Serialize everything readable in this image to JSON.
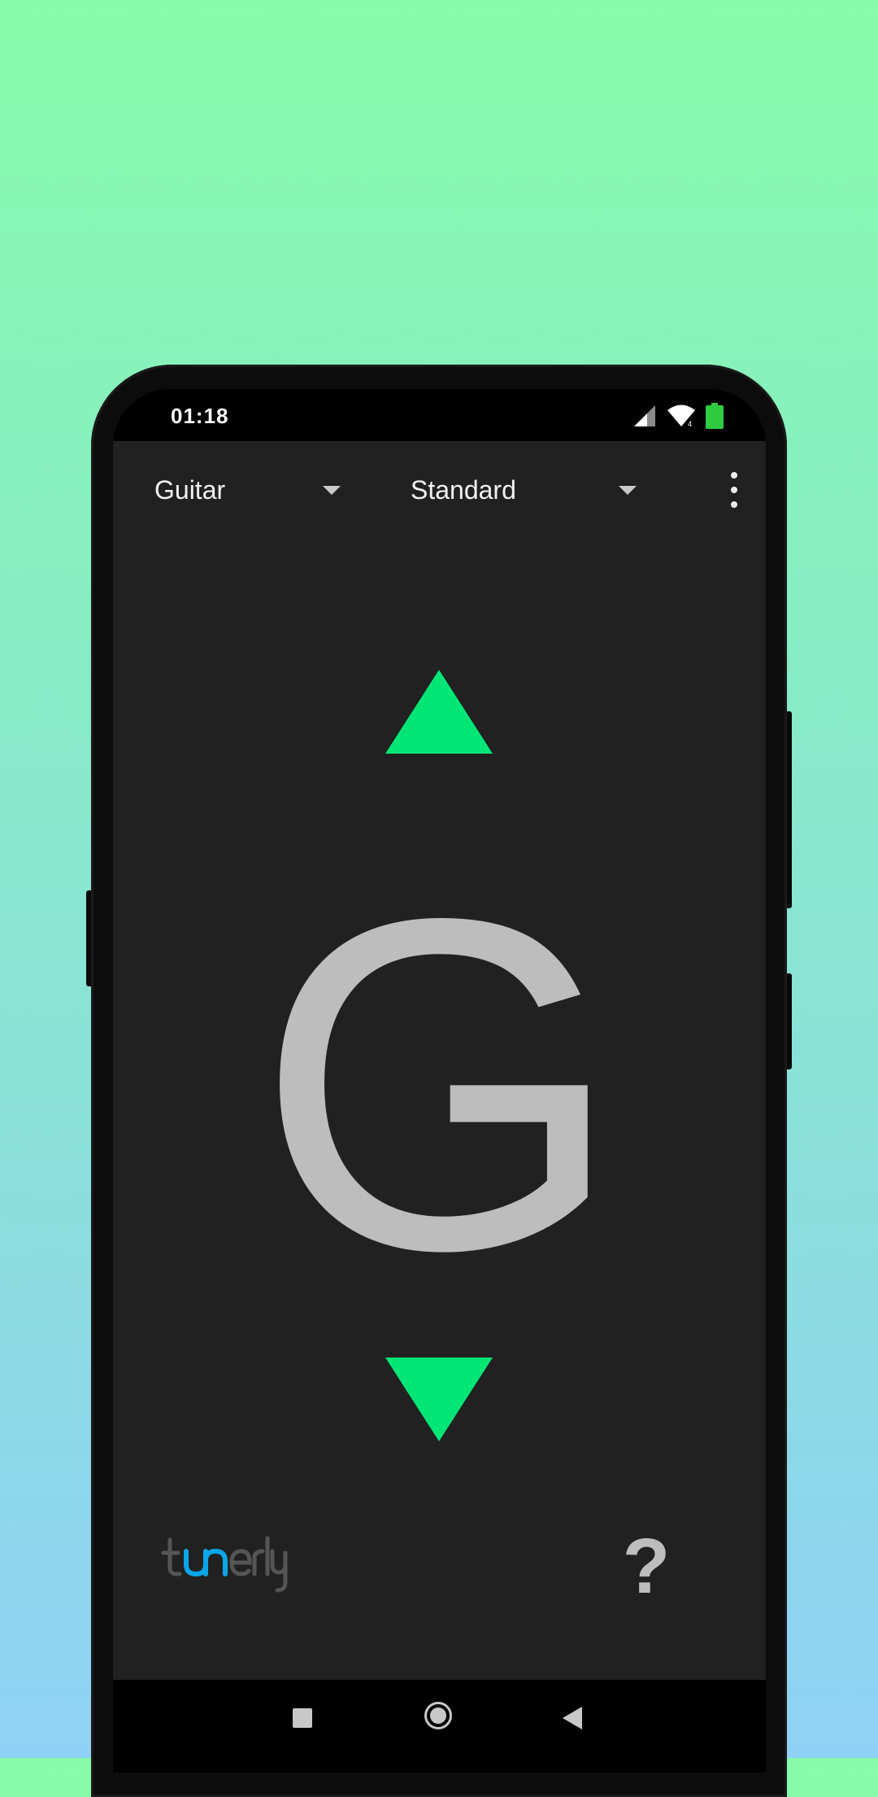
{
  "status_bar": {
    "time": "01:18",
    "icons": [
      "signal-icon",
      "wifi-icon",
      "battery-icon"
    ]
  },
  "toolbar": {
    "instrument": "Guitar",
    "tuning": "Standard",
    "menu_icon": "more-vert-icon"
  },
  "tuner": {
    "note": "G",
    "arrow_color": "#00e676",
    "note_color": "#bdbdbd"
  },
  "footer": {
    "logo": "tunerly",
    "help_label": "?"
  },
  "nav_bar": {
    "buttons": [
      "recents",
      "home",
      "back"
    ]
  },
  "colors": {
    "app_background": "#212121",
    "accent": "#00e676",
    "logo_accent": "#0aa6e8"
  }
}
